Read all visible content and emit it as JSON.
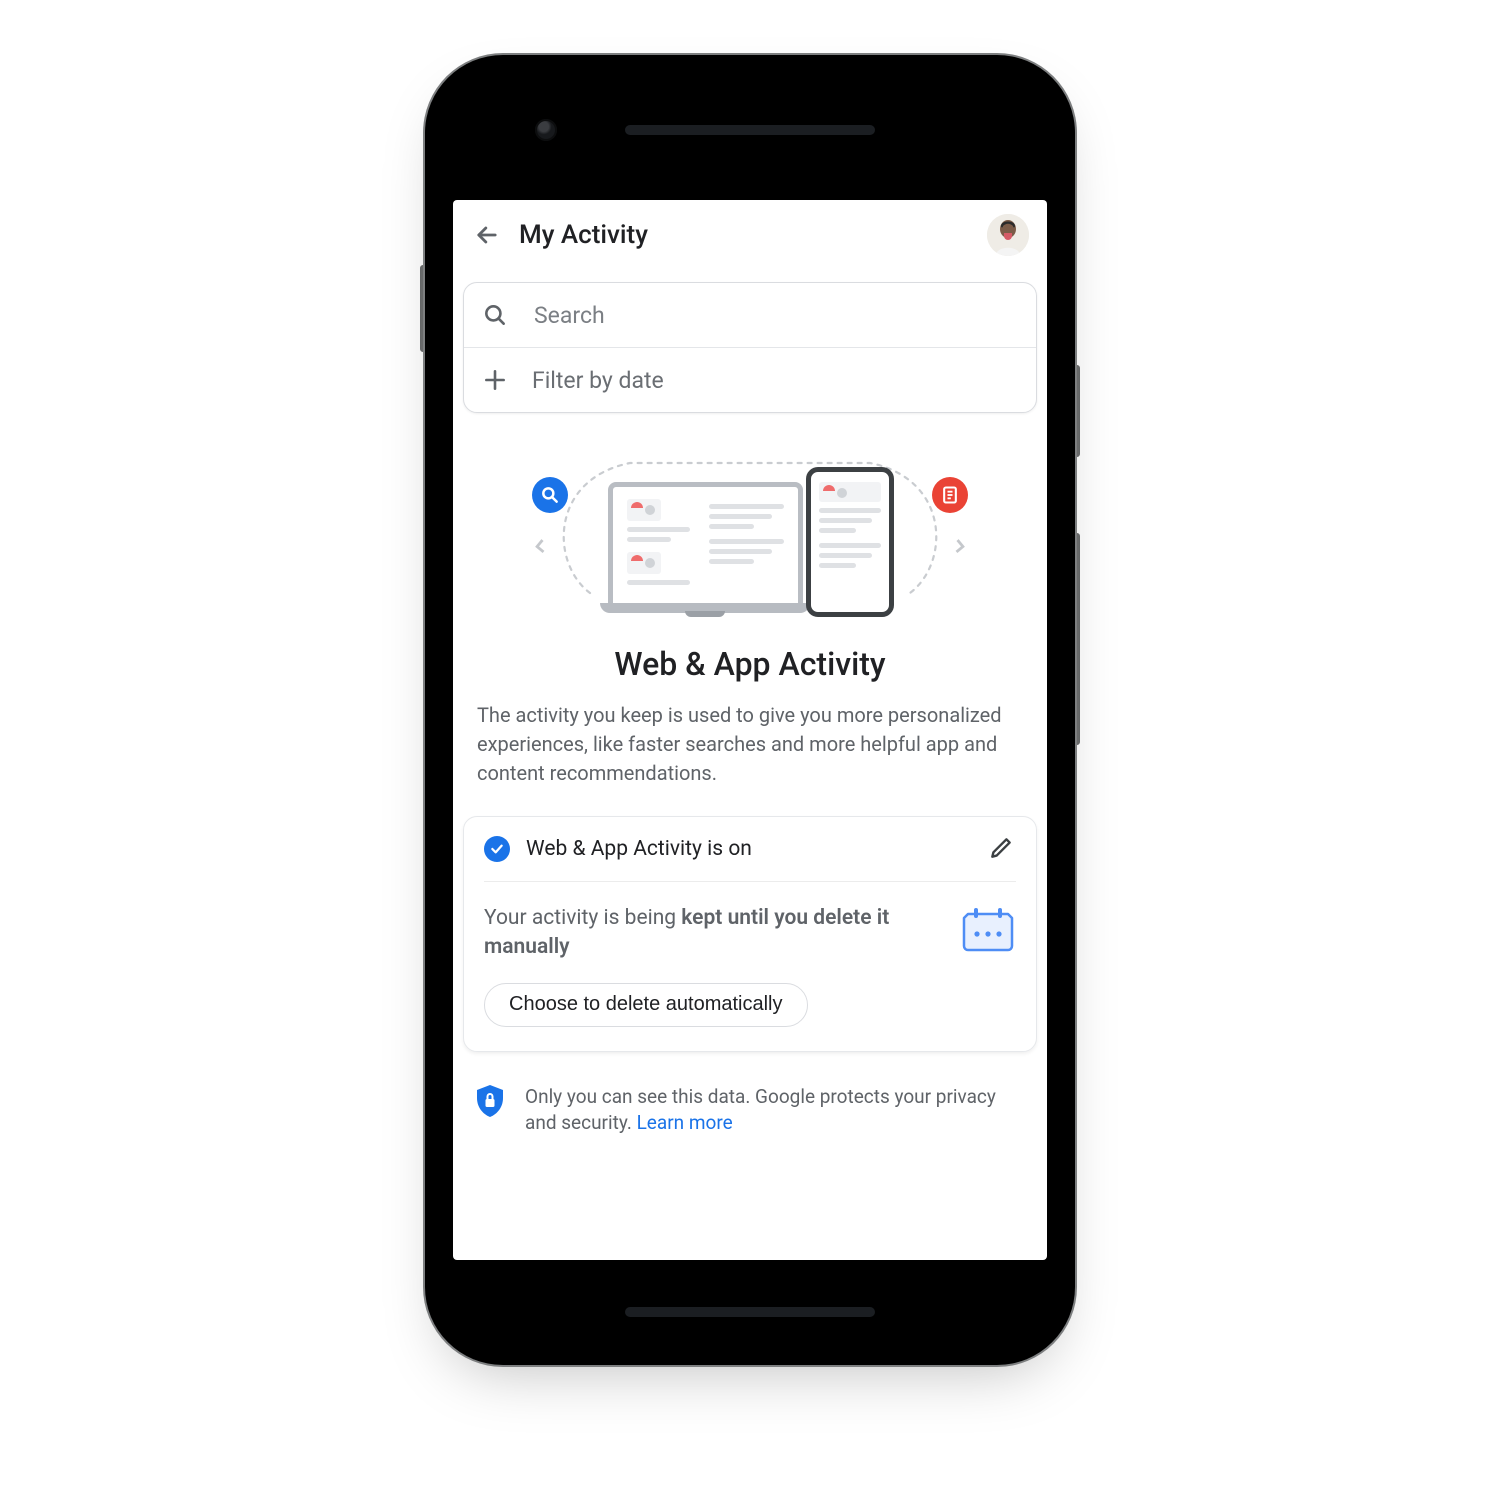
{
  "header": {
    "title": "My Activity"
  },
  "search": {
    "placeholder": "Search",
    "filter_label": "Filter by date"
  },
  "section": {
    "heading": "Web & App Activity",
    "description": "The activity you keep is used to give you more personalized experiences, like faster searches and more helpful app and content recommendations."
  },
  "card": {
    "status_label": "Web & App Activity is on",
    "retention_prefix": "Your activity is being ",
    "retention_bold": "kept until you delete it manually",
    "delete_button": "Choose to delete automatically"
  },
  "notice": {
    "text": "Only you can see this data. Google protects your privacy and security. ",
    "link": "Learn more"
  },
  "colors": {
    "accent": "#1a73e8",
    "danger": "#ea4335",
    "text_primary": "#202124",
    "text_secondary": "#5f6368"
  }
}
